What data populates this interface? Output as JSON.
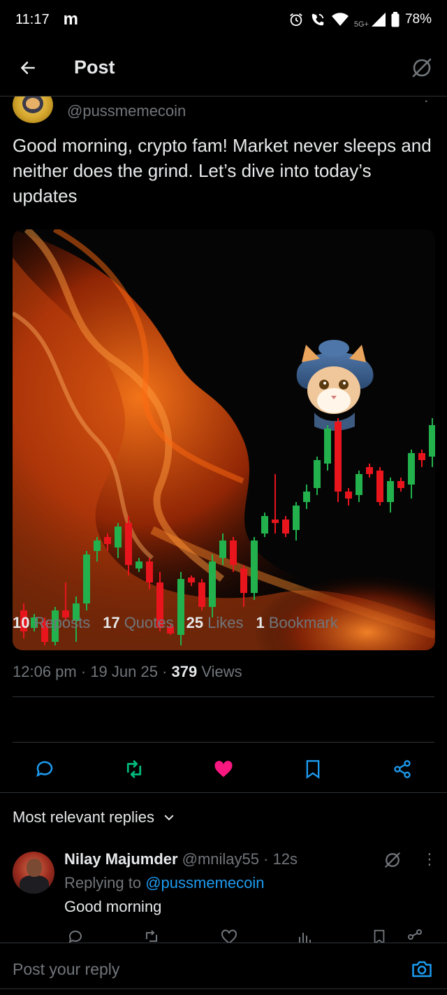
{
  "status_bar": {
    "time": "11:17",
    "notification_app": "m",
    "network": "5G+",
    "battery": "78%"
  },
  "topbar": {
    "title": "Post"
  },
  "post": {
    "handle": "@pussmemecoin",
    "text": "Good morning, crypto fam!  Market never sleeps and neither does the grind. Let’s dive into today’s updates",
    "meta": {
      "time": "12:06 pm",
      "date": "19 Jun 25",
      "views_count": "379",
      "views_label": "Views"
    },
    "stats": [
      {
        "count": "10",
        "label": "Reposts"
      },
      {
        "count": "17",
        "label": "Quotes"
      },
      {
        "count": "25",
        "label": "Likes"
      },
      {
        "count": "1",
        "label": "Bookmark"
      }
    ]
  },
  "replies_header": {
    "label": "Most relevant replies"
  },
  "reply": {
    "name": "Nilay Majumder",
    "handle": "@mnilay55",
    "age": "12s",
    "replying_prefix": "Replying to",
    "replying_to": "@pussmemecoin",
    "text": "Good morning"
  },
  "composer": {
    "placeholder": "Post your reply"
  },
  "colors": {
    "background": "#000000",
    "text": "#e7e9ea",
    "muted": "#71767b",
    "link": "#1d9bf0",
    "repost_active": "#00ba7c",
    "like_active": "#f91880",
    "candle_up": "#22b14c",
    "candle_down": "#e8151d"
  }
}
